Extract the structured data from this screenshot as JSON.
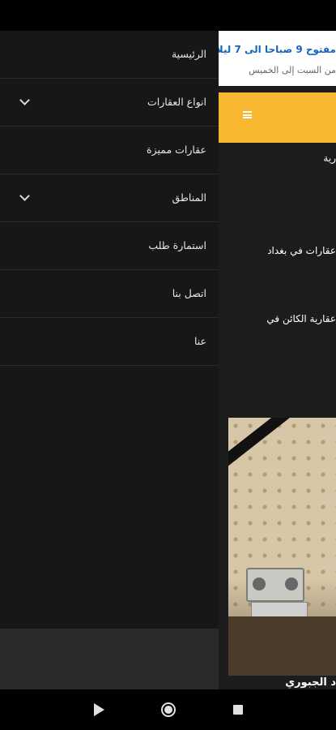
{
  "background_page": {
    "hours_text": "مفتوح 9 صباحا الى 7 ليلا",
    "days_text": "من السبت إلى الخميس",
    "header_menu_icon": "hamburger-icon",
    "header_accent": "#f7b731",
    "line1": "رية",
    "line2": "عقارات في بغداد",
    "line3": "عقارية الكائن في",
    "photo_caption": "د الجبوري"
  },
  "drawer": {
    "items": [
      {
        "label": "الرئيسية",
        "has_dropdown": false
      },
      {
        "label": "انواع العقارات",
        "has_dropdown": true,
        "icon": "chevron-down-icon"
      },
      {
        "label": "عقارات مميزة",
        "has_dropdown": false
      },
      {
        "label": "المناطق",
        "has_dropdown": true,
        "icon": "chevron-down-icon"
      },
      {
        "label": "استمارة طلب",
        "has_dropdown": false
      },
      {
        "label": "اتصل بنا",
        "has_dropdown": false
      },
      {
        "label": "عنا",
        "has_dropdown": false
      }
    ]
  },
  "navbar": {
    "back_icon": "back-triangle-icon",
    "home_icon": "home-circle-icon",
    "recents_icon": "recents-square-icon"
  }
}
